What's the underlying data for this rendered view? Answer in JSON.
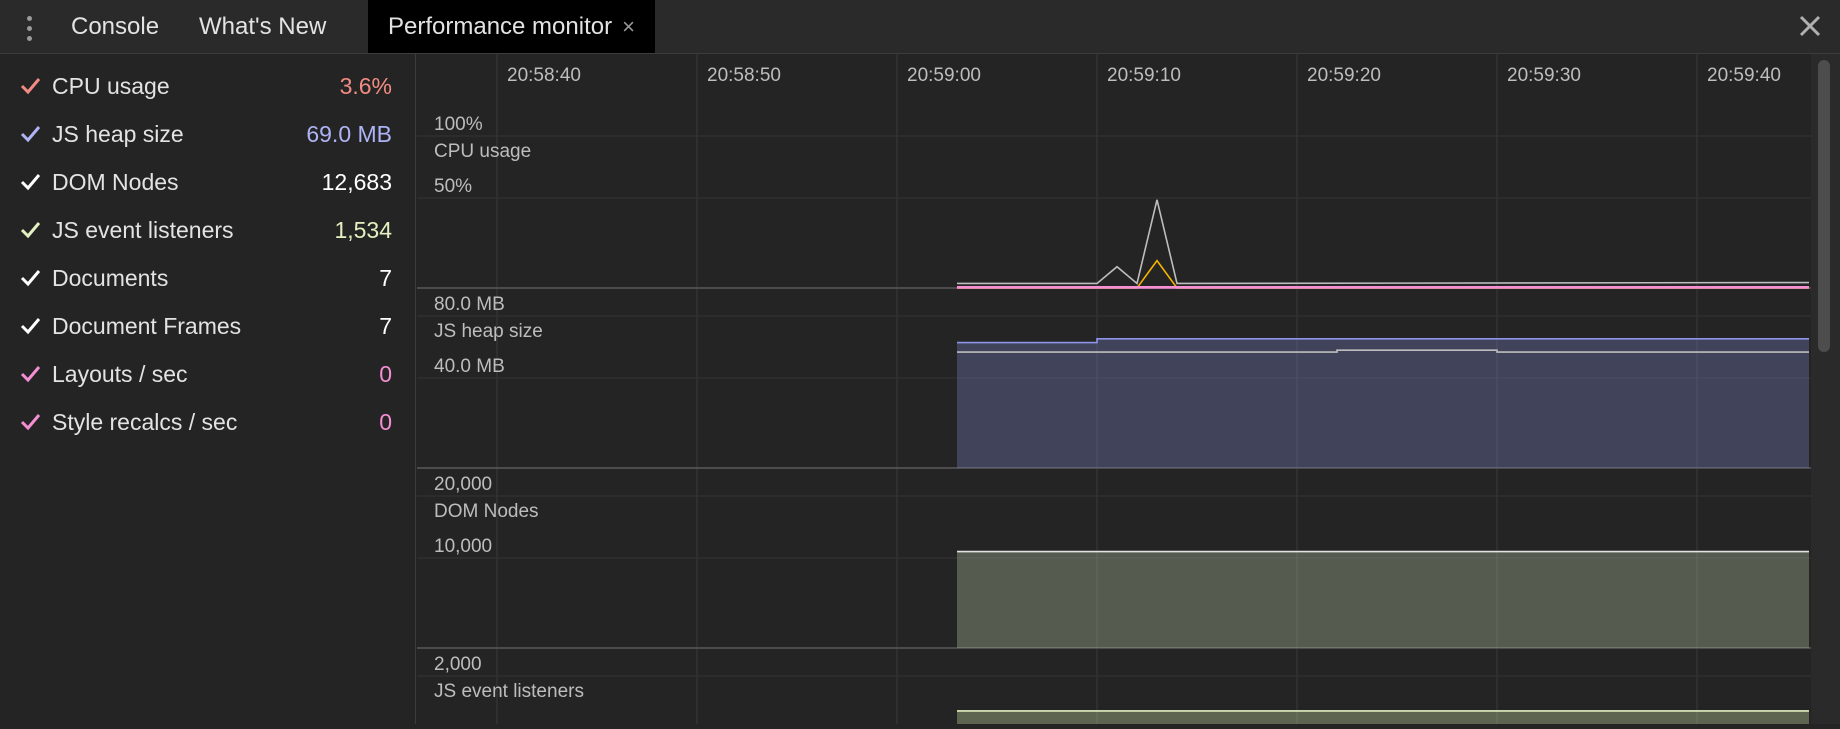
{
  "tabs": [
    {
      "label": "Console",
      "active": false
    },
    {
      "label": "What's New",
      "active": false
    },
    {
      "label": "Performance monitor",
      "active": true
    }
  ],
  "tab_close_glyph": "×",
  "icons": {
    "menu": "more-vertical-icon",
    "close": "close-icon",
    "check": "check-icon"
  },
  "metrics": [
    {
      "label": "CPU usage",
      "value": "3.6%",
      "color": "#f28b82"
    },
    {
      "label": "JS heap size",
      "value": "69.0 MB",
      "color": "#aeb4f5"
    },
    {
      "label": "DOM Nodes",
      "value": "12,683",
      "color": "#ffffff"
    },
    {
      "label": "JS event listeners",
      "value": "1,534",
      "color": "#e4f0c0"
    },
    {
      "label": "Documents",
      "value": "7",
      "color": "#ffffff"
    },
    {
      "label": "Document Frames",
      "value": "7",
      "color": "#ffffff"
    },
    {
      "label": "Layouts / sec",
      "value": "0",
      "color": "#f48fd3"
    },
    {
      "label": "Style recalcs / sec",
      "value": "0",
      "color": "#f48fd3"
    }
  ],
  "time_axis": {
    "ticks": [
      "20:58:40",
      "20:58:50",
      "20:59:00",
      "20:59:10",
      "20:59:20",
      "20:59:30",
      "20:59:40"
    ]
  },
  "chart_data": [
    {
      "type": "line",
      "title": "CPU usage",
      "y_tick_labels": [
        "100%",
        "50%"
      ],
      "ylim": [
        0,
        100
      ],
      "data_start": "20:59:03",
      "series": [
        {
          "color": "#bdbdbd",
          "x": [
            "20:59:03",
            "20:59:10",
            "20:59:11",
            "20:59:12",
            "20:59:13",
            "20:59:14",
            "20:59:40"
          ],
          "y": [
            3,
            3,
            14,
            3,
            58,
            3,
            3.6
          ]
        },
        {
          "color": "#f4b400",
          "x": [
            "20:59:03",
            "20:59:12",
            "20:59:13",
            "20:59:14",
            "20:59:40"
          ],
          "y": [
            0,
            0,
            18,
            0,
            0
          ]
        },
        {
          "color": "#f48fd3",
          "x": [
            "20:59:03",
            "20:59:40"
          ],
          "y": [
            0,
            0
          ]
        }
      ]
    },
    {
      "type": "area",
      "title": "JS heap size",
      "y_tick_labels": [
        "80.0 MB",
        "40.0 MB"
      ],
      "ylim": [
        0,
        100
      ],
      "data_start": "20:59:03",
      "series": [
        {
          "color": "#8c95e8",
          "x": [
            "20:59:03",
            "20:59:10",
            "20:59:10",
            "20:59:40"
          ],
          "y": [
            66,
            66,
            68,
            68
          ]
        },
        {
          "color": "#bdbdbd",
          "x": [
            "20:59:03",
            "20:59:22",
            "20:59:22",
            "20:59:30",
            "20:59:30",
            "20:59:40"
          ],
          "y": [
            61,
            61,
            62,
            62,
            61,
            61
          ]
        }
      ]
    },
    {
      "type": "area",
      "title": "DOM Nodes",
      "y_tick_labels": [
        "20,000",
        "10,000"
      ],
      "ylim": [
        0,
        25000
      ],
      "data_start": "20:59:03",
      "series": [
        {
          "color": "#e3e3e3",
          "x": [
            "20:59:03",
            "20:59:40"
          ],
          "y": [
            12683,
            12683
          ]
        }
      ]
    },
    {
      "type": "area",
      "title": "JS event listeners",
      "y_tick_labels": [
        "2,000"
      ],
      "ylim": [
        0,
        2500
      ],
      "data_start": "20:59:03",
      "series": [
        {
          "color": "#e4f0c0",
          "x": [
            "20:59:03",
            "20:59:40"
          ],
          "y": [
            1534,
            1534
          ]
        }
      ]
    }
  ]
}
